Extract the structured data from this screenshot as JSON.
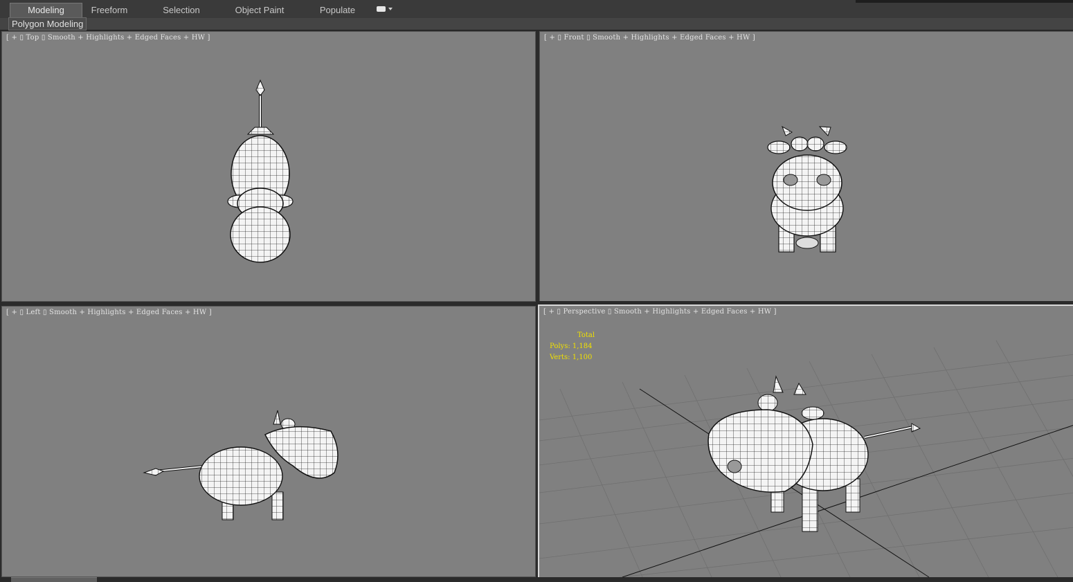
{
  "ribbon": {
    "tabs": [
      {
        "label": "Modeling",
        "active": true
      },
      {
        "label": "Freeform",
        "active": false
      },
      {
        "label": "Selection",
        "active": false
      },
      {
        "label": "Object Paint",
        "active": false
      },
      {
        "label": "Populate",
        "active": false
      }
    ],
    "dropdown_icon": "chevron-down-icon"
  },
  "panel": {
    "title": "Polygon Modeling"
  },
  "viewports": {
    "top": {
      "label": "[ + ▯ Top ▯ Smooth + Highlights + Edged Faces + HW ]"
    },
    "front": {
      "label": "[ + ▯ Front ▯ Smooth + Highlights + Edged Faces + HW ]"
    },
    "left": {
      "label": "[ + ▯ Left ▯ Smooth + Highlights + Edged Faces + HW ]"
    },
    "perspective": {
      "label": "[ + ▯ Perspective ▯ Smooth + Highlights + Edged Faces + HW ]"
    }
  },
  "stats": {
    "total_label": "Total",
    "polys": "Polys: 1,184",
    "verts": "Verts: 1,100"
  },
  "colors": {
    "viewport_bg": "#808080",
    "stats_text": "#f0e000",
    "ui_dark": "#3a3a3a"
  }
}
